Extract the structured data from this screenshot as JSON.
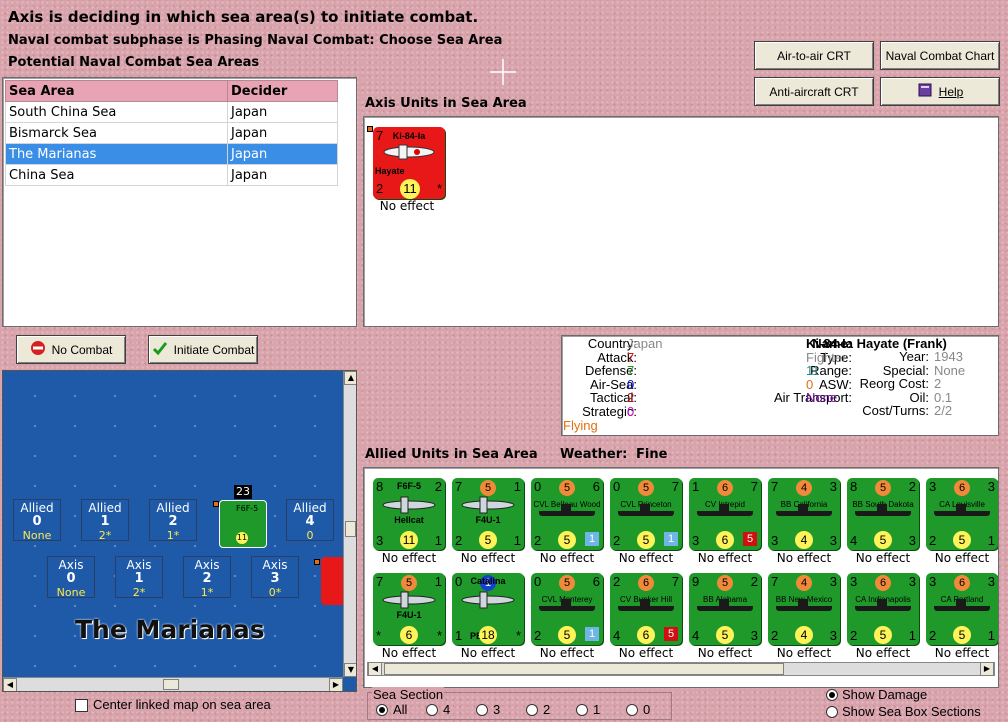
{
  "header": {
    "line1": "Axis is deciding in which sea area(s) to initiate combat.",
    "line2": "Naval combat subphase is Phasing Naval Combat: Choose Sea Area",
    "line3": "Potential Naval Combat Sea Areas"
  },
  "buttons": {
    "air_to_air": "Air-to-air CRT",
    "naval_chart": "Naval Combat Chart",
    "anti_aircraft": "Anti-aircraft CRT",
    "help": "Help",
    "no_combat": "No Combat",
    "initiate_combat": "Initiate Combat"
  },
  "sea_table": {
    "headers": [
      "Sea Area",
      "Decider"
    ],
    "rows": [
      {
        "area": "South China Sea",
        "decider": "Japan"
      },
      {
        "area": "Bismarck Sea",
        "decider": "Japan"
      },
      {
        "area": "The Marianas",
        "decider": "Japan"
      },
      {
        "area": "China Sea",
        "decider": "Japan"
      }
    ]
  },
  "axis_units": {
    "title": "Axis Units in Sea Area",
    "unit": {
      "name": "Ki-84-Ia",
      "sub": "Hayate",
      "tl": "7",
      "bl": "2",
      "circle": "11",
      "effect": "No effect"
    }
  },
  "details": {
    "country_l": "Country:",
    "country": "Japan",
    "attack_l": "Attack:",
    "attack": "7",
    "defense_l": "Defense:",
    "defense": "7",
    "airsea_l": "Air-Sea:",
    "airsea": "0",
    "tactical_l": "Tactical:",
    "tactical": "2",
    "strategic_l": "Strategic:",
    "strategic": "0",
    "status": "Flying",
    "name_l": "Name:",
    "name": "Ki-84-Ia Hayate (Frank)",
    "type_l": "Type:",
    "type": "Fighter",
    "range_l": "Range:",
    "range": "11",
    "asw_l": "ASW:",
    "asw": "0",
    "airtrans_l": "Air Transport:",
    "airtrans": "None",
    "year_l": "Year:",
    "year": "1943",
    "special_l": "Special:",
    "special": "None",
    "reorg_l": "Reorg Cost:",
    "reorg": "2",
    "oil_l": "Oil:",
    "oil": "0.1",
    "cost_l": "Cost/Turns:",
    "cost": "2/2"
  },
  "allied": {
    "title": "Allied Units in Sea Area",
    "weather_l": "Weather:",
    "weather": "Fine",
    "row1": [
      {
        "t": "F6F-5",
        "n": "Hellcat",
        "tl": "8",
        "tr": "2",
        "bl": "3",
        "br": "1",
        "c": "11",
        "cc": "y",
        "e": "No effect"
      },
      {
        "t": "",
        "n": "F4U-1",
        "tl": "7",
        "tr": "1",
        "bl": "2",
        "br": "1",
        "c": "5",
        "cc": "y",
        "top": "5",
        "e": "No effect"
      },
      {
        "t": "CVL Belleau Wood",
        "tl": "0",
        "tr": "6",
        "bl": "2",
        "br": "",
        "c": "5",
        "cc": "y",
        "top": "5",
        "sq": "1",
        "e": "No effect"
      },
      {
        "t": "CVL Princeton",
        "tl": "0",
        "tr": "7",
        "bl": "2",
        "br": "",
        "c": "5",
        "cc": "y",
        "top": "5",
        "sq": "1",
        "e": "No effect"
      },
      {
        "t": "CV Intrepid",
        "tl": "1",
        "tr": "7",
        "bl": "3",
        "br": "",
        "c": "6",
        "cc": "y",
        "top": "6",
        "sq": "5",
        "e": "No effect"
      },
      {
        "t": "BB California",
        "tl": "7",
        "tr": "3",
        "bl": "3",
        "br": "3",
        "c": "4",
        "cc": "y",
        "top": "4",
        "e": "No effect"
      },
      {
        "t": "BB South Dakota",
        "tl": "8",
        "tr": "2",
        "bl": "4",
        "br": "3",
        "c": "5",
        "cc": "y",
        "top": "5",
        "e": "No effect"
      },
      {
        "t": "CA Louisville",
        "tl": "3",
        "tr": "3",
        "bl": "2",
        "br": "1",
        "c": "5",
        "cc": "y",
        "top": "6",
        "e": "No effect"
      }
    ],
    "row2": [
      {
        "t": "",
        "n": "F4U-1",
        "tl": "7",
        "tr": "1",
        "bl": "*",
        "br": "*",
        "c": "6",
        "cc": "y",
        "top": "5",
        "e": "No effect"
      },
      {
        "t": "Catalina",
        "n": "PBY-1",
        "tl": "0",
        "tr": "",
        "bl": "1",
        "br": "*",
        "c": "18",
        "cc": "y",
        "top": "1",
        "e": "No effect"
      },
      {
        "t": "CVL Monterey",
        "tl": "0",
        "tr": "6",
        "bl": "2",
        "br": "",
        "c": "5",
        "cc": "y",
        "top": "5",
        "sq": "1",
        "e": "No effect"
      },
      {
        "t": "CV Bunker Hill",
        "tl": "2",
        "tr": "7",
        "bl": "4",
        "br": "",
        "c": "6",
        "cc": "y",
        "top": "6",
        "sq": "5",
        "e": "No effect"
      },
      {
        "t": "BB Alabama",
        "tl": "9",
        "tr": "2",
        "bl": "4",
        "br": "3",
        "c": "5",
        "cc": "y",
        "top": "5",
        "e": "No effect"
      },
      {
        "t": "BB New Mexico",
        "tl": "7",
        "tr": "3",
        "bl": "2",
        "br": "3",
        "c": "4",
        "cc": "y",
        "top": "4",
        "e": "No effect"
      },
      {
        "t": "CA Indianapolis",
        "tl": "3",
        "tr": "3",
        "bl": "2",
        "br": "1",
        "c": "5",
        "cc": "y",
        "top": "6",
        "e": "No effect"
      },
      {
        "t": "CA Portland",
        "tl": "3",
        "tr": "3",
        "bl": "2",
        "br": "1",
        "c": "5",
        "cc": "y",
        "top": "6",
        "e": "No effect"
      }
    ]
  },
  "map": {
    "title": "The Marianas",
    "stack_count": "23",
    "allied_boxes": [
      {
        "label": "Allied",
        "val": "0",
        "sub": "None"
      },
      {
        "label": "Allied",
        "val": "1",
        "sub": "2*"
      },
      {
        "label": "Allied",
        "val": "2",
        "sub": "1*"
      },
      {
        "label": "Allied",
        "val": "4",
        "sub": "0"
      }
    ],
    "axis_boxes": [
      {
        "label": "Axis",
        "val": "0",
        "sub": "None"
      },
      {
        "label": "Axis",
        "val": "1",
        "sub": "2*"
      },
      {
        "label": "Axis",
        "val": "2",
        "sub": "1*"
      },
      {
        "label": "Axis",
        "val": "3",
        "sub": "0*"
      }
    ],
    "center_link": "Center linked map on sea area"
  },
  "sea_section": {
    "title": "Sea Section",
    "options": [
      "All",
      "4",
      "3",
      "2",
      "1",
      "0"
    ],
    "selected": "All"
  },
  "display": {
    "show_damage": "Show Damage",
    "show_sea_box": "Show Sea Box Sections"
  },
  "colors": {
    "accent_select": "#3a8ee6",
    "sea": "#1e5aa8",
    "allied_unit": "#1f9a2a",
    "axis_unit": "#e81818"
  }
}
